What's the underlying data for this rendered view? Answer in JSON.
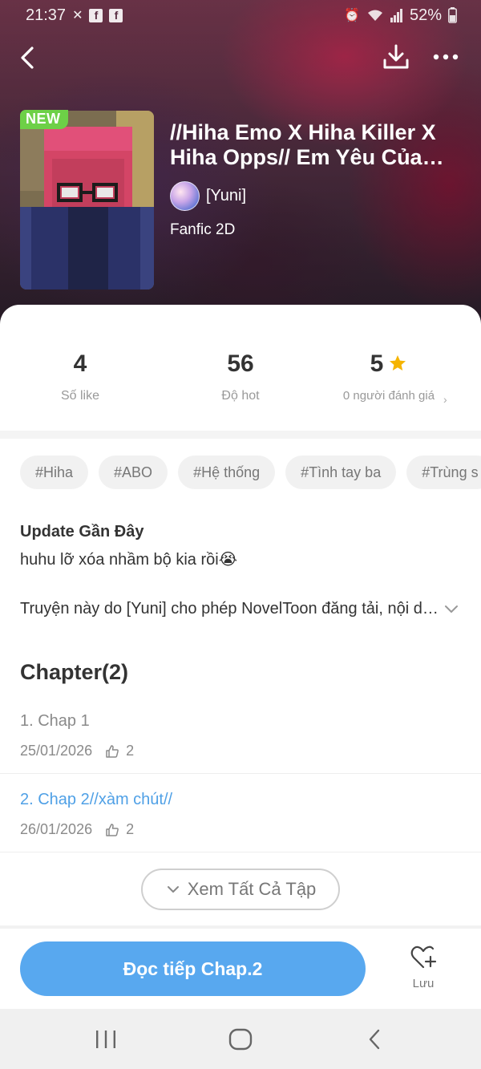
{
  "status_bar": {
    "time": "21:37",
    "battery": "52%"
  },
  "hero": {
    "badge": "NEW",
    "title": "//Hiha Emo X Hiha Killer X Hiha Opps// Em Yêu Của Ha...",
    "author": "[Yuni]",
    "genre": "Fanfic 2D"
  },
  "stats": {
    "likes_value": "4",
    "likes_label": "Số like",
    "hot_value": "56",
    "hot_label": "Độ hot",
    "rating_value": "5",
    "rating_label": "0 người đánh giá"
  },
  "tags": [
    "#Hiha",
    "#ABO",
    "#Hệ thống",
    "#Tình tay ba",
    "#Trùng s"
  ],
  "update": {
    "heading": "Update Gần Đây",
    "text": "huhu lỡ xóa nhầm bộ kia rồi😭"
  },
  "description": "Truyện này do [Yuni] cho phép NovelToon đăng tải, nội dung truyện...",
  "chapters": {
    "heading": "Chapter(2)",
    "items": [
      {
        "title": "1. Chap 1",
        "date": "25/01/2026",
        "likes": "2",
        "active": false
      },
      {
        "title": "2. Chap 2//xàm chút//",
        "date": "26/01/2026",
        "likes": "2",
        "active": true
      }
    ]
  },
  "see_all_label": "Xem Tất Cả Tập",
  "bottom_bar": {
    "read_label": "Đọc tiếp Chap.2",
    "save_label": "Lưu"
  },
  "colors": {
    "accent": "#58a8ef",
    "active_chapter": "#4fa0e6",
    "new_badge": "#6dd047",
    "star": "#f5b400"
  },
  "icons": {
    "back": "chevron-left-icon",
    "download": "download-icon",
    "more": "more-icon",
    "star": "star-icon",
    "thumbs_up": "thumbs-up-icon",
    "save": "heart-plus-icon"
  }
}
